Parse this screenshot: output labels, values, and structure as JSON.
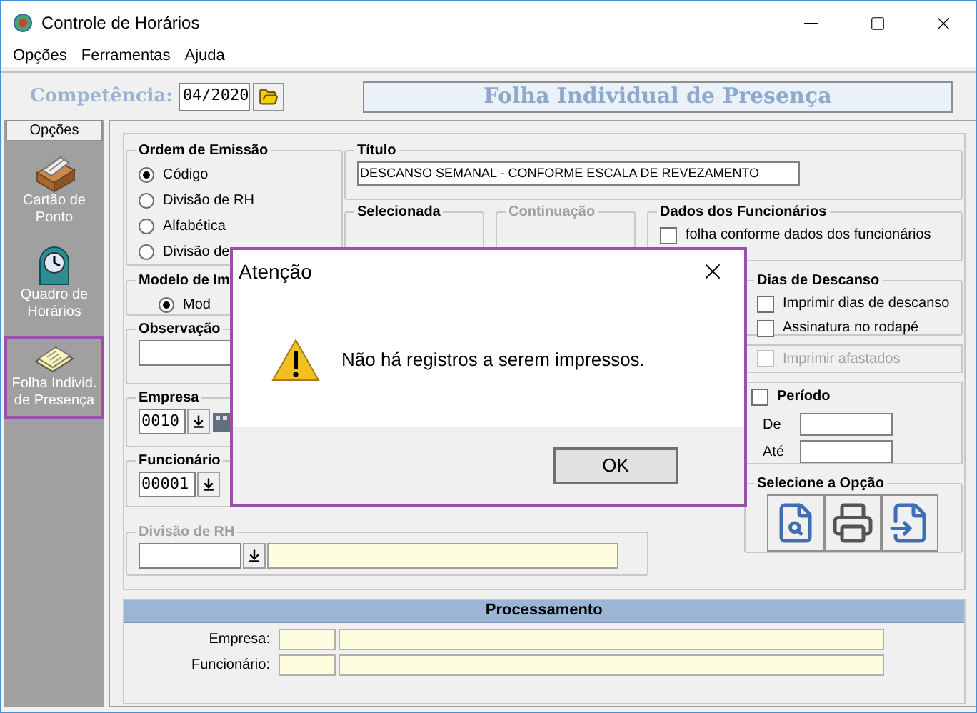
{
  "window": {
    "title": "Controle de Horários"
  },
  "menu": [
    "Opções",
    "Ferramentas",
    "Ajuda"
  ],
  "toolbar": {
    "competencia_label": "Competência:",
    "competencia_value": "04/2020",
    "page_title": "Folha Individual de Presença"
  },
  "sidebar": {
    "header": "Opções",
    "items": [
      {
        "kind": "cards",
        "label": "Cartão de Ponto",
        "selected": false
      },
      {
        "kind": "clock",
        "label": "Quadro de Horários",
        "selected": false
      },
      {
        "kind": "sheets",
        "label": "Folha Individ. de Presença",
        "selected": true
      }
    ]
  },
  "form": {
    "ordem_emissao": {
      "title": "Ordem de Emissão",
      "options": [
        {
          "label": "Código",
          "selected": true
        },
        {
          "label": "Divisão de RH",
          "selected": false
        },
        {
          "label": "Alfabética",
          "selected": false
        },
        {
          "label": "Divisão de",
          "selected": false
        }
      ]
    },
    "titulo": {
      "title": "Título",
      "value": "DESCANSO SEMANAL - CONFORME ESCALA DE REVEZAMENTO"
    },
    "selecionada": {
      "title": "Selecionada"
    },
    "continuacao": {
      "title": "Continuação",
      "disabled": true
    },
    "dados_funcionarios": {
      "title": "Dados dos Funcionários",
      "checkbox": {
        "label": "folha conforme dados dos funcionários",
        "checked": false
      }
    },
    "modelo": {
      "title": "Modelo de Im",
      "option": {
        "label": "Mod",
        "selected": true
      }
    },
    "observacao": {
      "title": "Observação"
    },
    "empresa": {
      "title": "Empresa",
      "code": "0010"
    },
    "funcionario": {
      "title": "Funcionário",
      "code": "00001"
    },
    "divisao_rh": {
      "title": "Divisão de RH",
      "disabled": true
    },
    "dias_descanso": {
      "title": "Dias de Descanso",
      "options": [
        {
          "label": "Imprimir dias de descanso",
          "checked": false
        },
        {
          "label": "Assinatura no rodapé",
          "checked": false
        }
      ]
    },
    "imprimir_afastados": {
      "label": "Imprimir afastados",
      "checked": false,
      "disabled": true
    },
    "periodo": {
      "title": "Período",
      "checked": false,
      "from_label": "De",
      "to_label": "Até"
    },
    "selecione": {
      "title": "Selecione a Opção"
    }
  },
  "processamento": {
    "title": "Processamento",
    "rows": [
      {
        "label": "Empresa:"
      },
      {
        "label": "Funcionário:"
      }
    ]
  },
  "dialog": {
    "title": "Atenção",
    "message": "Não há registros a serem impressos.",
    "button": "OK"
  }
}
